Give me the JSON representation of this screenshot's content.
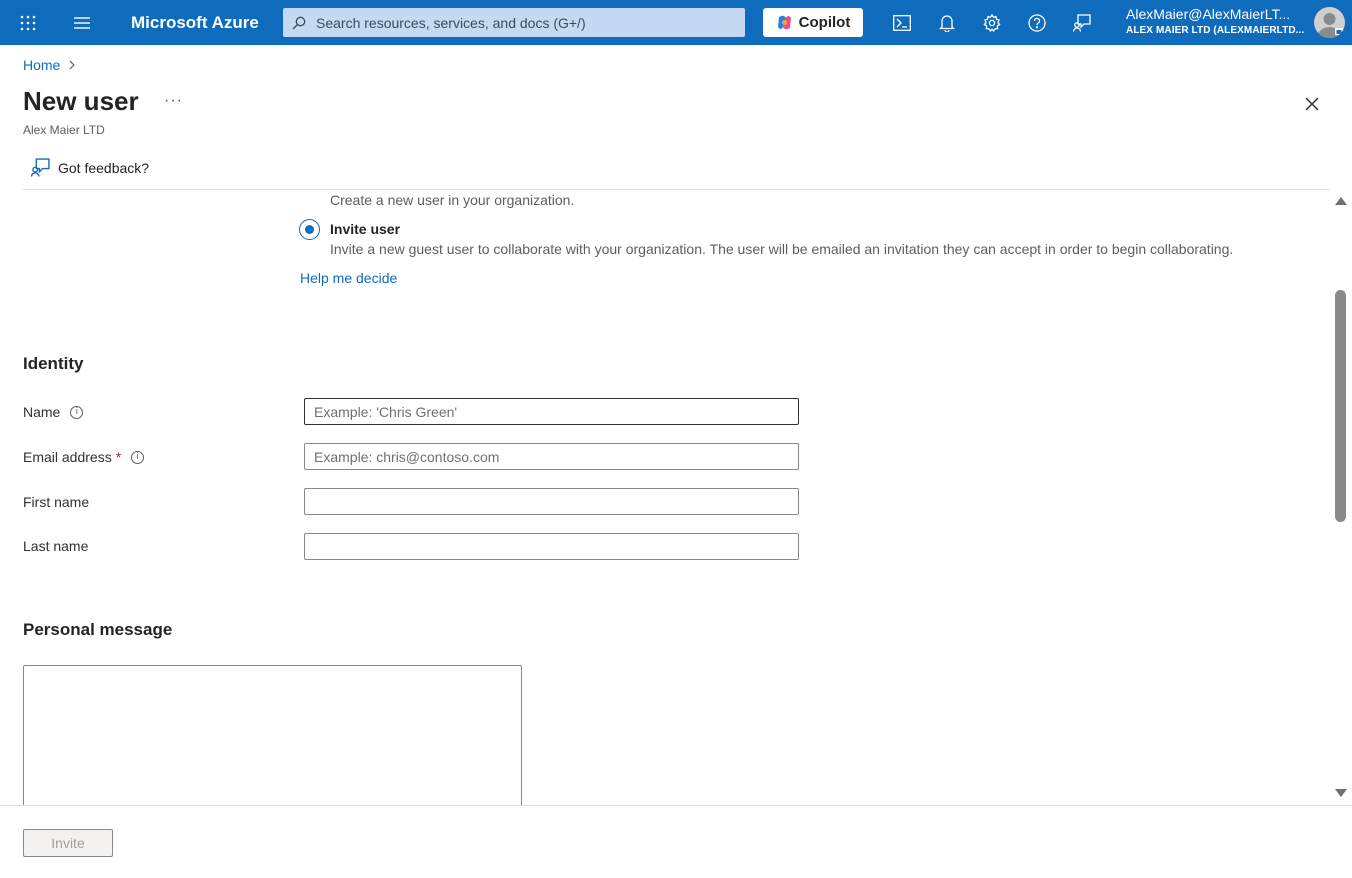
{
  "topbar": {
    "brand": "Microsoft Azure",
    "search_placeholder": "Search resources, services, and docs (G+/)",
    "copilot_label": "Copilot",
    "account_email": "AlexMaier@AlexMaierLT...",
    "account_tenant": "ALEX MAIER LTD (ALEXMAIERLTD...",
    "icons": [
      "apps-grid-icon",
      "hamburger-menu-icon",
      "search-icon",
      "copilot-icon",
      "cloud-shell-icon",
      "notifications-icon",
      "settings-icon",
      "help-icon",
      "feedback-icon",
      "avatar"
    ],
    "bar_color": "#0f6cbd"
  },
  "breadcrumb": {
    "home": "Home"
  },
  "header": {
    "title": "New user",
    "more_label": "···",
    "subtitle": "Alex Maier LTD",
    "feedback_label": "Got feedback?"
  },
  "invite_options": {
    "create_description": "Create a new user in your organization.",
    "invite_label": "Invite user",
    "invite_selected": true,
    "invite_description": "Invite a new guest user to collaborate with your organization. The user will be emailed an invitation they can accept in order to begin collaborating.",
    "help_link": "Help me decide"
  },
  "identity": {
    "heading": "Identity",
    "name_label": "Name",
    "name_placeholder": "Example: 'Chris Green'",
    "email_label": "Email address",
    "email_required": "*",
    "email_placeholder": "Example: chris@contoso.com",
    "first_name_label": "First name",
    "last_name_label": "Last name"
  },
  "personal_message": {
    "heading": "Personal message"
  },
  "footer": {
    "invite_button": "Invite"
  }
}
